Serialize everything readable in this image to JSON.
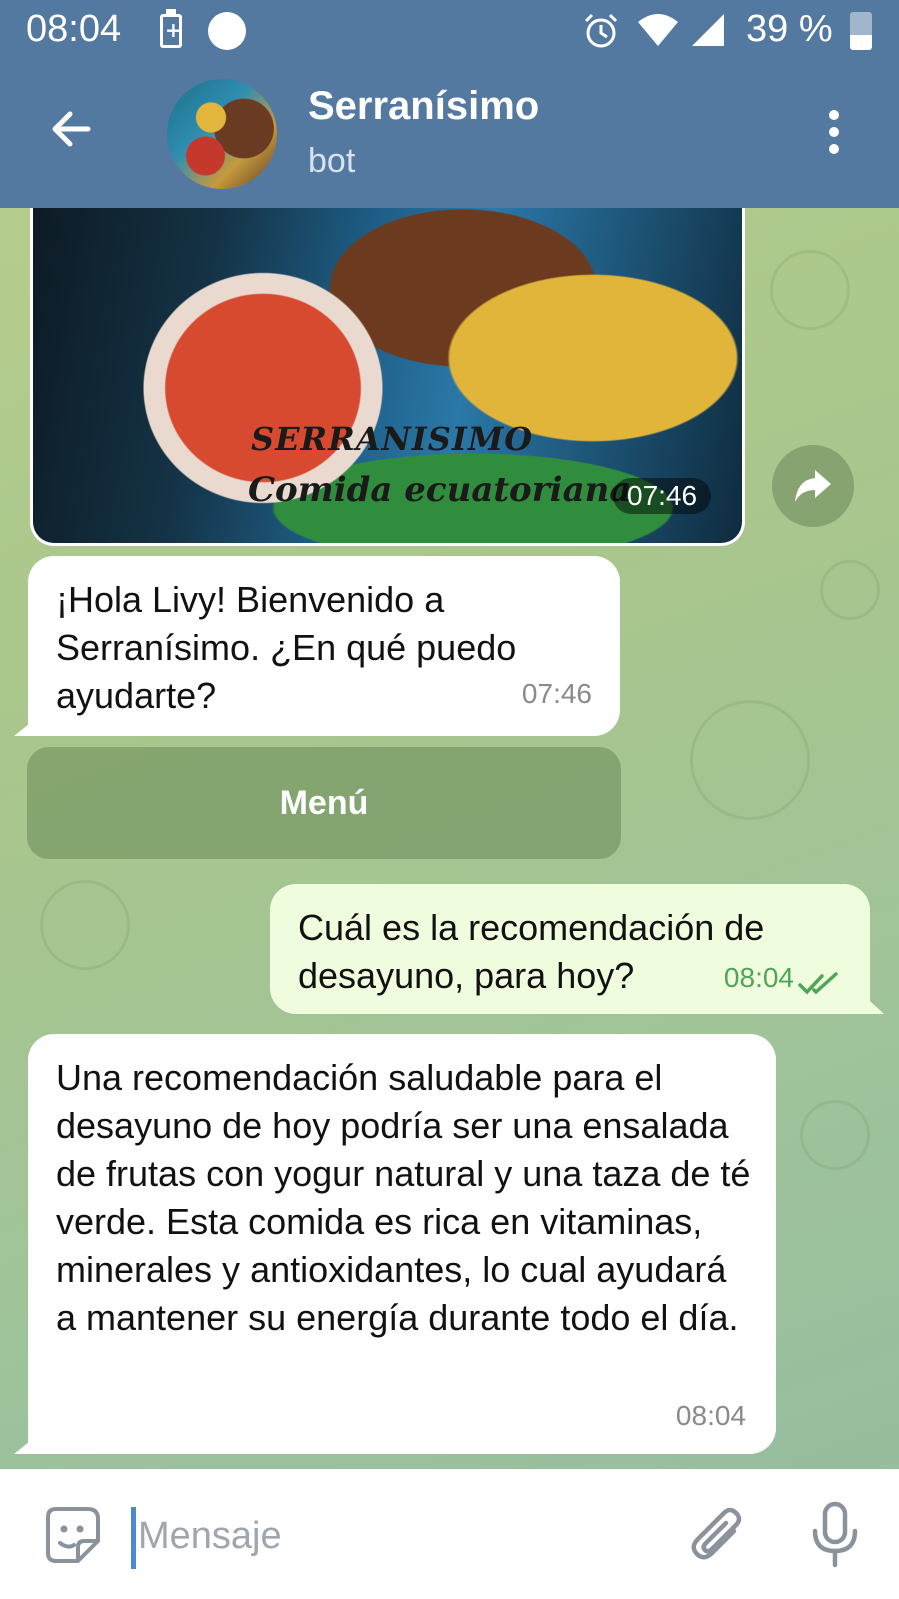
{
  "status_bar": {
    "time": "08:04",
    "battery_pct": "39 %",
    "icons": [
      "battery-charging-icon",
      "notification-dot-icon",
      "alarm-icon",
      "wifi-icon",
      "signal-icon",
      "battery-icon"
    ]
  },
  "header": {
    "title": "Serranísimo",
    "subtitle": "bot",
    "icons": [
      "back-arrow-icon",
      "more-vertical-icon"
    ]
  },
  "messages": {
    "photo": {
      "caption_line1": "SERRANISIMO",
      "caption_line2": "Comida ecuatoriana",
      "time": "07:46"
    },
    "greeting": {
      "text": "¡Hola Livy! Bienvenido a Serranísimo. ¿En qué puedo ayudarte?",
      "time": "07:46"
    },
    "menu_button": {
      "label": "Menú"
    },
    "user_question": {
      "text": "Cuál es la recomendación de desayuno, para hoy?",
      "time": "08:04",
      "status": "read"
    },
    "bot_answer": {
      "text": "Una recomendación saludable para el desayuno de hoy podría ser una ensalada de frutas con yogur natural y una taza de té verde. Esta comida es rica en vitaminas, minerales y antioxidantes, lo cual ayudará a mantener su energía durante todo el día.",
      "time": "08:04"
    }
  },
  "composer": {
    "placeholder": "Mensaje",
    "icons": [
      "sticker-icon",
      "attach-icon",
      "microphone-icon"
    ]
  },
  "colors": {
    "header_bg": "#5479a0",
    "outgoing_bubble": "#effdde",
    "incoming_bubble": "#ffffff",
    "read_check": "#4fa557"
  }
}
